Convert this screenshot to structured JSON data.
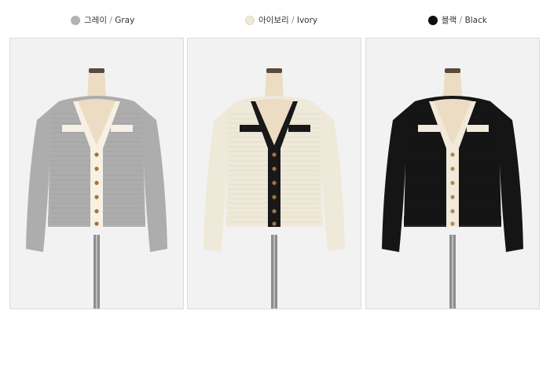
{
  "colors": [
    {
      "name_ko": "그레이",
      "sep": "/",
      "name_en": "Gray",
      "swatch": "#b3b3b3",
      "body": "#adadad",
      "trim": "#f6f1e4",
      "button": "#a0743e"
    },
    {
      "name_ko": "아이보리",
      "sep": "/",
      "name_en": "Ivory",
      "swatch": "#efe9da",
      "body": "#efe9d9",
      "trim": "#181818",
      "button": "#a0743e"
    },
    {
      "name_ko": "블랙",
      "sep": "/",
      "name_en": "Black",
      "swatch": "#0e0e0e",
      "body": "#151515",
      "trim": "#f1eadb",
      "button": "#b08a4e"
    }
  ],
  "ui": {
    "panel_bg": "#f2f2f2",
    "border": "#dcdcdc"
  }
}
